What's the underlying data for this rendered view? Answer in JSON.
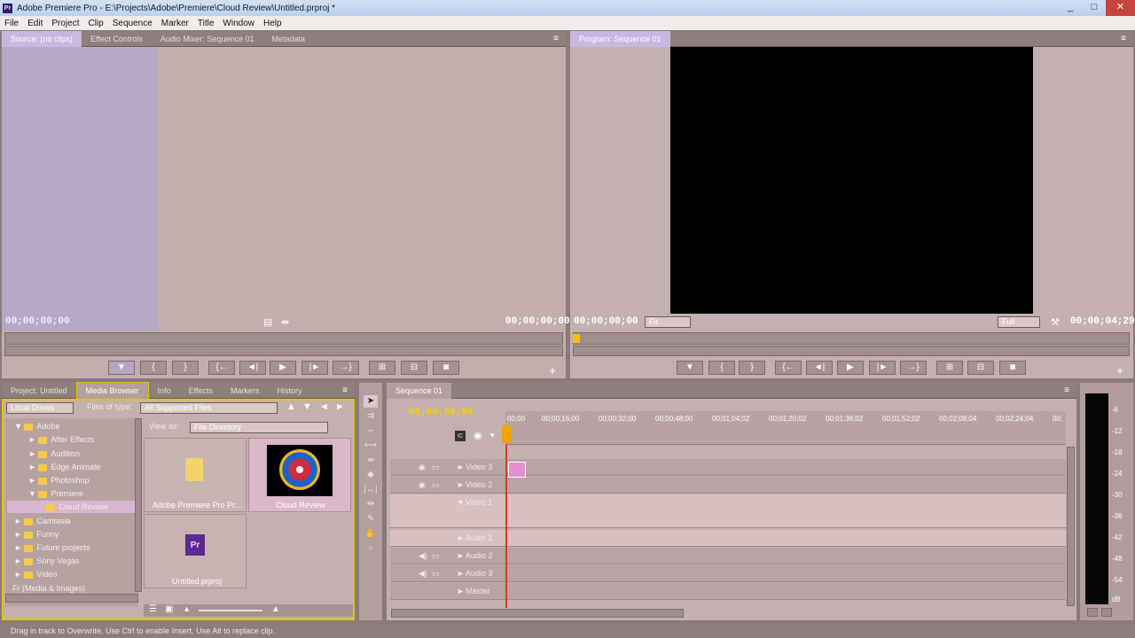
{
  "app": {
    "title": "Adobe Premiere Pro - E:\\Projects\\Adobe\\Premiere\\Cloud Review\\Untitled.prproj *",
    "icon": "premiere-icon",
    "window_controls": [
      "_",
      "□",
      "✕"
    ]
  },
  "menu": [
    "File",
    "Edit",
    "Project",
    "Clip",
    "Sequence",
    "Marker",
    "Title",
    "Window",
    "Help"
  ],
  "source_monitor": {
    "tabs": [
      "Source: (no clips)",
      "Effect Controls",
      "Audio Mixer: Sequence 01",
      "Metadata"
    ],
    "timecode_left": "00;00;00;00",
    "timecode_right": "00;00;00;00",
    "buttons": [
      "▼",
      "{",
      "}",
      "{←",
      "◄|",
      "▶",
      "|►",
      "→}",
      "⊞",
      "⊟",
      "◙"
    ],
    "add": "+"
  },
  "program_monitor": {
    "tab": "Program: Sequence 01",
    "timecode_left": "00;00;00;00",
    "fit": "Fit",
    "quality": "Full",
    "timecode_right": "00;00;04;29",
    "buttons": [
      "▼",
      "{",
      "}",
      "{←",
      "◄|",
      "▶",
      "|►",
      "→}",
      "⊞",
      "⊟",
      "◙"
    ],
    "add": "+"
  },
  "project_panel": {
    "tabs": [
      "Project: Untitled",
      "Media Browser",
      "Info",
      "Effects",
      "Markers",
      "History"
    ],
    "local_drives": "Local Drives",
    "files_of_type_label": "Files of type:",
    "files_of_type": "All Supported Files",
    "view_as_label": "View as:",
    "view_as": "File Directory",
    "tree": [
      {
        "label": "Adobe",
        "expanded": true
      },
      {
        "label": "After Effects"
      },
      {
        "label": "Audition"
      },
      {
        "label": "Edge Animate"
      },
      {
        "label": "Photoshop"
      },
      {
        "label": "Premiere",
        "expanded": true
      },
      {
        "label": "Cloud Review",
        "selected": true
      },
      {
        "label": "Camtasia"
      },
      {
        "label": "Funny"
      },
      {
        "label": "Future projects"
      },
      {
        "label": "Sony Vegas"
      },
      {
        "label": "Video"
      },
      {
        "label": "Fr (Media & Images)"
      }
    ],
    "thumbnails": [
      {
        "label": "Adobe Premiere Pro Pr...",
        "kind": "folder-icon"
      },
      {
        "label": "Cloud Review",
        "kind": "image"
      },
      {
        "label": "Untitled.prproj",
        "kind": "premiere-file-icon",
        "badge": "Pr"
      }
    ]
  },
  "timeline": {
    "tab": "Sequence 01",
    "playhead_timecode": "00;00;00;00",
    "ruler": [
      "00;00",
      "00;00;16;00",
      "00;00;32;00",
      "00;00;48;00",
      "00;01;04;02",
      "00;01;20;02",
      "00;01;36;02",
      "00;01;52;02",
      "00;02;08;04",
      "00;02;24;04",
      "00;"
    ],
    "tracks": [
      "Video 3",
      "Video 2",
      "Video 1",
      "Audio 1",
      "Audio 2",
      "Audio 3",
      "Master"
    ]
  },
  "audio_meter": {
    "scale": [
      "-6",
      "-12",
      "-18",
      "-24",
      "-30",
      "-36",
      "-42",
      "-48",
      "-54",
      "dB"
    ]
  },
  "status_bar": "Drag in track to Overwrite. Use Ctrl to enable Insert. Use Alt to replace clip.",
  "colors": {
    "panel_bg": "#c4b0b0",
    "timecode_yellow": "#f4d000",
    "playhead_red": "#e03a2a",
    "title_bar": "#c2d8f2"
  }
}
